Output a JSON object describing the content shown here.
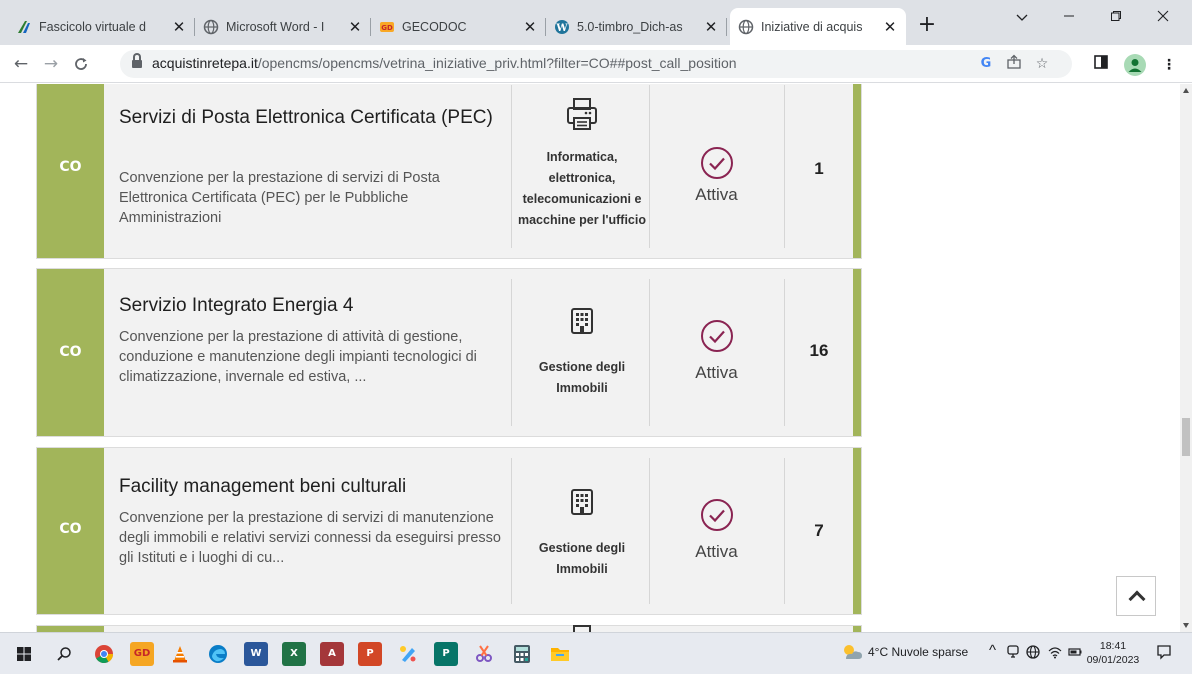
{
  "browser": {
    "tabs": [
      {
        "title": "Fascicolo virtuale d",
        "icon": "fascicolo-logo-icon"
      },
      {
        "title": "Microsoft Word - I",
        "icon": "globe-icon"
      },
      {
        "title": "GECODOC",
        "icon": "gecodoc-logo-icon"
      },
      {
        "title": "5.0-timbro_Dich-as",
        "icon": "wordpress-icon"
      },
      {
        "title": "Iniziative di acquis",
        "icon": "globe-icon"
      }
    ],
    "new_tab": "+",
    "url_host": "acquistinretepa.it",
    "url_path": "/opencms/opencms/vetrina_iniziative_priv.html?filter=CO##post_call_position"
  },
  "cards": [
    {
      "code": "CO",
      "title": "Servizi di Posta Elettronica Certificata (PEC)",
      "description": "Convenzione per la prestazione di servizi di Posta Elettronica Certificata (PEC) per le Pubbliche Amministrazioni",
      "category_icon": "printer-icon",
      "category": "Informatica, elettronica, telecomunicazioni e macchine per l'ufficio",
      "status": "Attiva",
      "count": "1"
    },
    {
      "code": "CO",
      "title": "Servizio Integrato Energia 4",
      "description": "Convenzione per la prestazione di attività di gestione, conduzione e manutenzione degli impianti tecnologici di climatizzazione, invernale ed estiva, ...",
      "category_icon": "building-icon",
      "category": "Gestione degli Immobili",
      "status": "Attiva",
      "count": "16"
    },
    {
      "code": "CO",
      "title": "Facility management beni culturali",
      "description": "Convenzione per la prestazione di servizi di manutenzione degli immobili e relativi servizi connessi da eseguirsi presso gli Istituti e i luoghi di cu...",
      "category_icon": "building-icon",
      "category": "Gestione degli Immobili",
      "status": "Attiva",
      "count": "7"
    }
  ],
  "colors": {
    "accent_green": "#a2b55a",
    "status_purple": "#8a2452",
    "card_bg": "#f2f2f2"
  },
  "taskbar": {
    "weather": "4°C  Nuvole sparse",
    "time": "18:41",
    "date": "09/01/2023"
  }
}
